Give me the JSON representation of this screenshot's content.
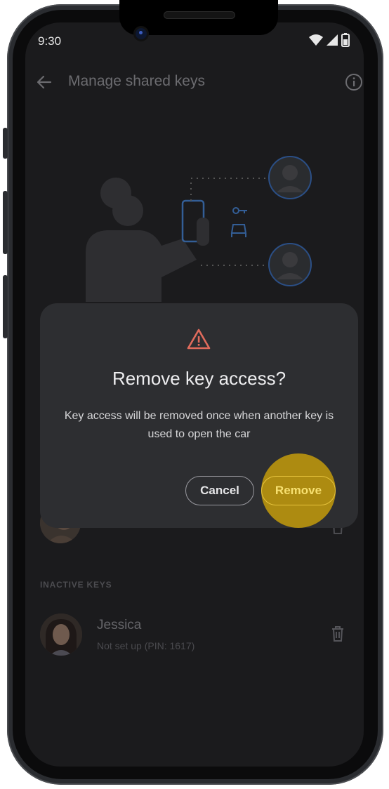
{
  "status_bar": {
    "time": "9:30"
  },
  "app_bar": {
    "title": "Manage shared keys"
  },
  "dialog": {
    "title": "Remove key access?",
    "body": "Key access will be removed once when another key is used to open the car",
    "cancel_label": "Cancel",
    "remove_label": "Remove"
  },
  "inactive_section": {
    "label": "INACTIVE KEYS",
    "items": [
      {
        "name": "Jessica",
        "subtitle": "Not set up (PIN: 1617)"
      }
    ]
  },
  "colors": {
    "dialog_bg": "#2d2e31",
    "warning": "#e06b5c",
    "accent": "#e6c33d",
    "touch_indicator": "#b8940e",
    "illustration_blue": "#3a6fb5"
  },
  "icons": [
    "back-arrow-icon",
    "info-icon",
    "wifi-icon",
    "signal-icon",
    "battery-icon",
    "warning-icon",
    "car-key-icon",
    "trash-icon"
  ]
}
